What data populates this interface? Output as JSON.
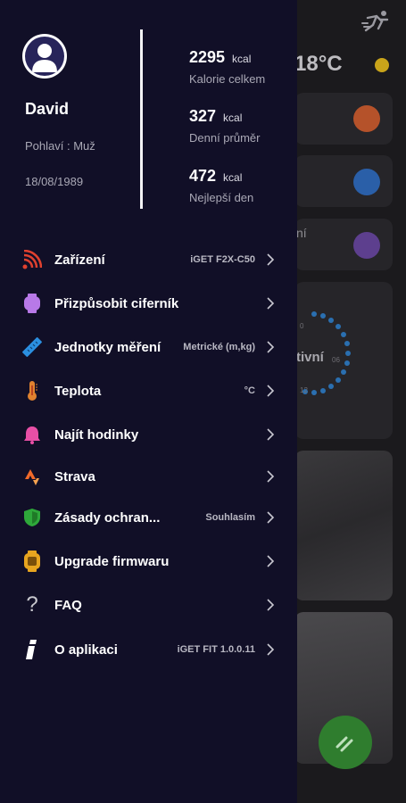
{
  "background": {
    "temperature": "18°C",
    "partial_text_1": "ní",
    "partial_text_2": "tivní",
    "ring_ticks": [
      "0",
      "06",
      "12"
    ]
  },
  "profile": {
    "name": "David",
    "gender": "Pohlaví : Muž",
    "birthdate": "18/08/1989"
  },
  "stats": [
    {
      "value": "2295",
      "unit": "kcal",
      "label": "Kalorie celkem"
    },
    {
      "value": "327",
      "unit": "kcal",
      "label": "Denní průměr"
    },
    {
      "value": "472",
      "unit": "kcal",
      "label": "Nejlepší den"
    }
  ],
  "menu": [
    {
      "label": "Zařízení",
      "value": "iGET F2X-C50",
      "icon": "signal-icon",
      "color": "#e0412f"
    },
    {
      "label": "Přizpůsobit ciferník",
      "value": "",
      "icon": "watch-icon",
      "color": "#b879e8"
    },
    {
      "label": "Jednotky měření",
      "value": "Metrické (m,kg)",
      "icon": "ruler-icon",
      "color": "#2b8fe0"
    },
    {
      "label": "Teplota",
      "value": "°C",
      "icon": "thermometer-icon",
      "color": "#e0822f"
    },
    {
      "label": "Najít hodinky",
      "value": "",
      "icon": "bell-icon",
      "color": "#e84fa6"
    },
    {
      "label": "Strava",
      "value": "",
      "icon": "strava-icon",
      "color": "#f06a2a"
    },
    {
      "label": "Zásady ochran...",
      "value": "Souhlasím",
      "icon": "shield-icon",
      "color": "#2ea83a"
    },
    {
      "label": "Upgrade firmwaru",
      "value": "",
      "icon": "firmware-icon",
      "color": "#e8a51f"
    },
    {
      "label": "FAQ",
      "value": "",
      "icon": "question-icon",
      "color": "#c9c9cf"
    },
    {
      "label": "O aplikaci",
      "value": "iGET FIT 1.0.0.11",
      "icon": "info-icon",
      "color": "#ffffff"
    }
  ]
}
